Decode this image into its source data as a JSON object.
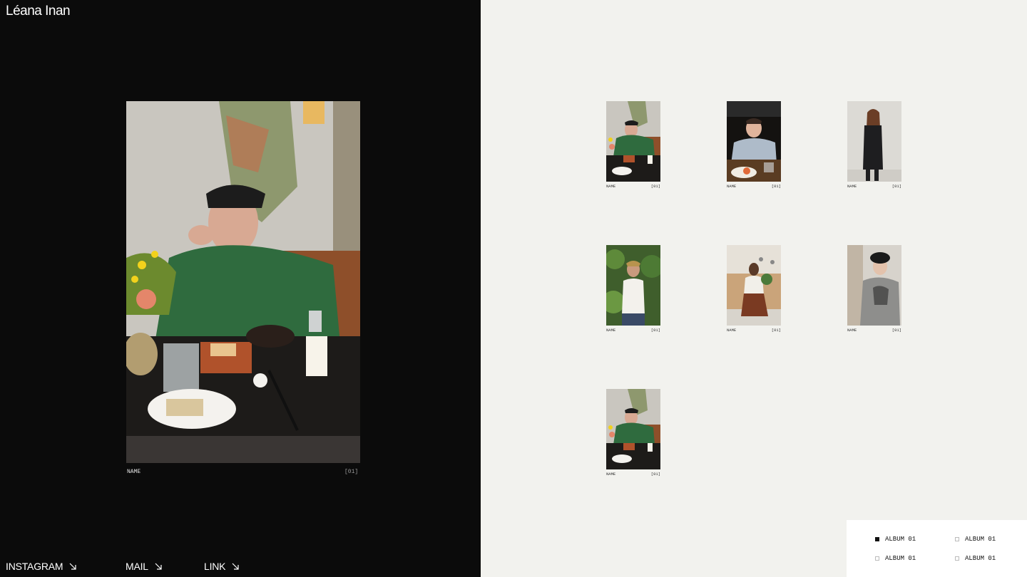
{
  "site": {
    "title": "Léana Inan"
  },
  "hero": {
    "caption_name": "NAME",
    "caption_num": "[01]"
  },
  "footer": {
    "links": [
      {
        "label": "INSTAGRAM",
        "icon": "arrow-down-right-icon"
      },
      {
        "label": "MAIL",
        "icon": "arrow-down-right-icon"
      },
      {
        "label": "LINK",
        "icon": "arrow-down-right-icon"
      }
    ]
  },
  "gallery": {
    "items": [
      {
        "name": "NAME",
        "num": "[01]"
      },
      {
        "name": "NAME",
        "num": "[01]"
      },
      {
        "name": "NAME",
        "num": "[01]"
      },
      {
        "name": "NAME",
        "num": "[01]"
      },
      {
        "name": "NAME",
        "num": "[01]"
      },
      {
        "name": "NAME",
        "num": "[01]"
      },
      {
        "name": "NAME",
        "num": "[01]"
      }
    ]
  },
  "albums": {
    "items": [
      {
        "label": "ALBUM 01",
        "selected": true
      },
      {
        "label": "ALBUM 01",
        "selected": false
      },
      {
        "label": "ALBUM 01",
        "selected": false
      },
      {
        "label": "ALBUM 01",
        "selected": false
      }
    ]
  },
  "colors": {
    "left_bg": "#0b0b0b",
    "right_bg": "#f2f2ee",
    "text_light": "#ffffff"
  }
}
